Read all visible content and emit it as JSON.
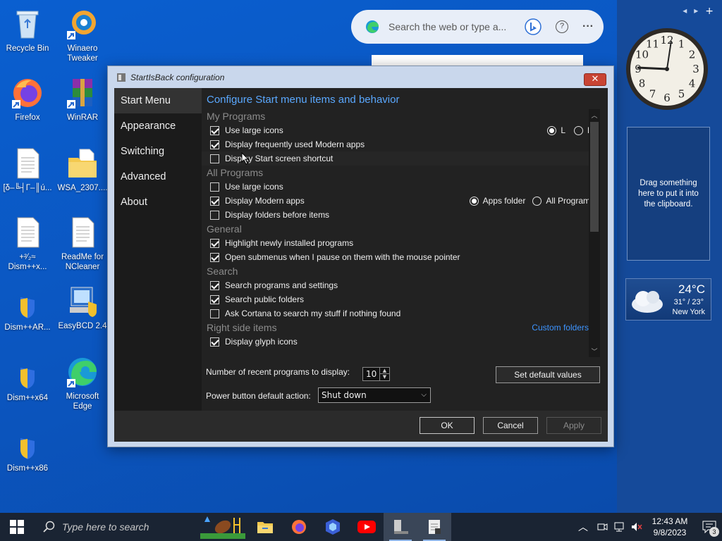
{
  "desktop": {
    "icons": [
      {
        "label": "Recycle Bin"
      },
      {
        "label": "Winaero Tweaker"
      },
      {
        "label": "Firefox"
      },
      {
        "label": "WinRAR"
      },
      {
        "label": "[δ–╚┤Г–║ú..."
      },
      {
        "label": "WSA_2307...."
      },
      {
        "label": "+²⁄₂≈ Dism++x..."
      },
      {
        "label": "ReadMe for NCleaner"
      },
      {
        "label": "Dism++AR..."
      },
      {
        "label": "EasyBCD 2.4"
      },
      {
        "label": "Dism++x64"
      },
      {
        "label": "Microsoft Edge"
      },
      {
        "label": "Dism++x86"
      }
    ]
  },
  "search_pill": {
    "placeholder": "Search the web or type a...",
    "more": "···",
    "help": "?"
  },
  "gadgets": {
    "nav_prev": "◂",
    "nav_next": "▸",
    "nav_add": "+",
    "clipboard_text": "Drag something here to put it into the clipboard.",
    "weather": {
      "temp": "24°C",
      "range": "31° / 23°",
      "city": "New York"
    },
    "clock_numbers": [
      "12",
      "1",
      "2",
      "3",
      "4",
      "5",
      "6",
      "7",
      "8",
      "9",
      "10",
      "11"
    ]
  },
  "dialog": {
    "title": "StartIsBack configuration",
    "close": "✕",
    "nav": [
      "Start Menu",
      "Appearance",
      "Switching",
      "Advanced",
      "About"
    ],
    "heading": "Configure Start menu items and behavior",
    "sections": {
      "my_programs": "My Programs",
      "all_programs": "All Programs",
      "general": "General",
      "search": "Search",
      "right_side": "Right side items"
    },
    "options": {
      "mp_large_icons": "Use large icons",
      "mp_modern_apps": "Display frequently used Modern apps",
      "mp_start_screen": "Display Start screen shortcut",
      "ap_large_icons": "Use large icons",
      "ap_modern_apps": "Display Modern apps",
      "ap_folders_before": "Display folders before items",
      "gen_highlight": "Highlight newly installed programs",
      "gen_submenus": "Open submenus when I pause on them with the mouse pointer",
      "search_programs": "Search programs and settings",
      "search_public": "Search public folders",
      "search_cortana": "Ask Cortana to search my stuff if nothing found",
      "rs_glyph": "Display glyph icons"
    },
    "radios": {
      "size_l": "L",
      "size_m": "M",
      "apps_folder": "Apps folder",
      "all_programs": "All Programs"
    },
    "custom_folders": "Custom folders...",
    "recent_label": "Number of recent programs to display:",
    "recent_value": "10",
    "spin_up": "▲",
    "spin_down": "▼",
    "set_defaults": "Set default values",
    "power_label": "Power button default action:",
    "power_value": "Shut down",
    "select_chevron": "⌵",
    "ok": "OK",
    "cancel": "Cancel",
    "apply": "Apply"
  },
  "taskbar": {
    "search_placeholder": "Type here to search",
    "time": "12:43 AM",
    "date": "9/8/2023",
    "notifications": "3"
  }
}
